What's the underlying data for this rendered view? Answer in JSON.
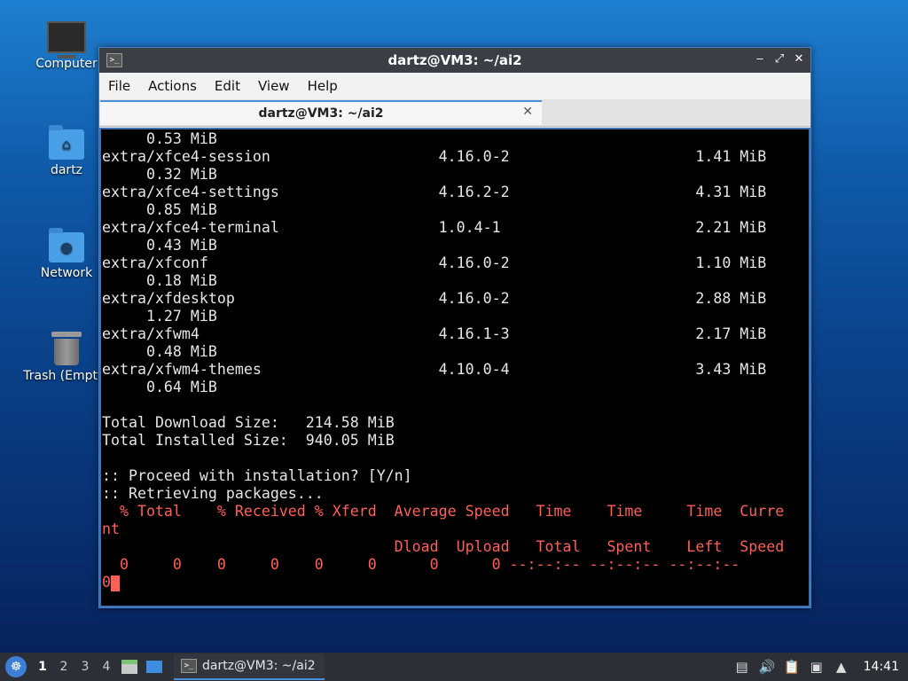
{
  "desktop": {
    "icons": [
      {
        "label": "Computer"
      },
      {
        "label": "dartz"
      },
      {
        "label": "Network"
      },
      {
        "label": "Trash (Empty)"
      }
    ]
  },
  "window": {
    "title": "dartz@VM3: ~/ai2",
    "app_icon": ">_",
    "buttons": {
      "minimize": "‒",
      "maximize": "⤢",
      "close": "✕"
    },
    "menu": [
      "File",
      "Actions",
      "Edit",
      "View",
      "Help"
    ],
    "tab": {
      "title": "dartz@VM3: ~/ai2",
      "close": "✕"
    }
  },
  "terminal": {
    "lines": [
      {
        "text": "     0.53 MiB"
      },
      {
        "text": "extra/xfce4-session                   4.16.0-2                     1.41 MiB"
      },
      {
        "text": "     0.32 MiB"
      },
      {
        "text": "extra/xfce4-settings                  4.16.2-2                     4.31 MiB"
      },
      {
        "text": "     0.85 MiB"
      },
      {
        "text": "extra/xfce4-terminal                  1.0.4-1                      2.21 MiB"
      },
      {
        "text": "     0.43 MiB"
      },
      {
        "text": "extra/xfconf                          4.16.0-2                     1.10 MiB"
      },
      {
        "text": "     0.18 MiB"
      },
      {
        "text": "extra/xfdesktop                       4.16.0-2                     2.88 MiB"
      },
      {
        "text": "     1.27 MiB"
      },
      {
        "text": "extra/xfwm4                           4.16.1-3                     2.17 MiB"
      },
      {
        "text": "     0.48 MiB"
      },
      {
        "text": "extra/xfwm4-themes                    4.10.0-4                     3.43 MiB"
      },
      {
        "text": "     0.64 MiB"
      },
      {
        "text": ""
      },
      {
        "text": "Total Download Size:   214.58 MiB"
      },
      {
        "text": "Total Installed Size:  940.05 MiB"
      },
      {
        "text": ""
      },
      {
        "text": ":: Proceed with installation? [Y/n]"
      },
      {
        "text": ":: Retrieving packages..."
      },
      {
        "text": "  % Total    % Received % Xferd  Average Speed   Time    Time     Time  Curre",
        "red": true
      },
      {
        "text": "nt",
        "red": true
      },
      {
        "text": "                                 Dload  Upload   Total   Spent    Left  Speed",
        "red": true
      },
      {
        "text": "  0     0    0     0    0     0      0      0 --:--:-- --:--:-- --:--:--",
        "red": true
      },
      {
        "text": "0",
        "red": true,
        "cursor": true
      }
    ]
  },
  "taskbar": {
    "menu_icon": "☸",
    "workspaces": [
      "1",
      "2",
      "3",
      "4"
    ],
    "active_workspace": "1",
    "task": {
      "title": "dartz@VM3: ~/ai2",
      "icon": ">_"
    },
    "tray": {
      "clock": "14:41"
    }
  }
}
